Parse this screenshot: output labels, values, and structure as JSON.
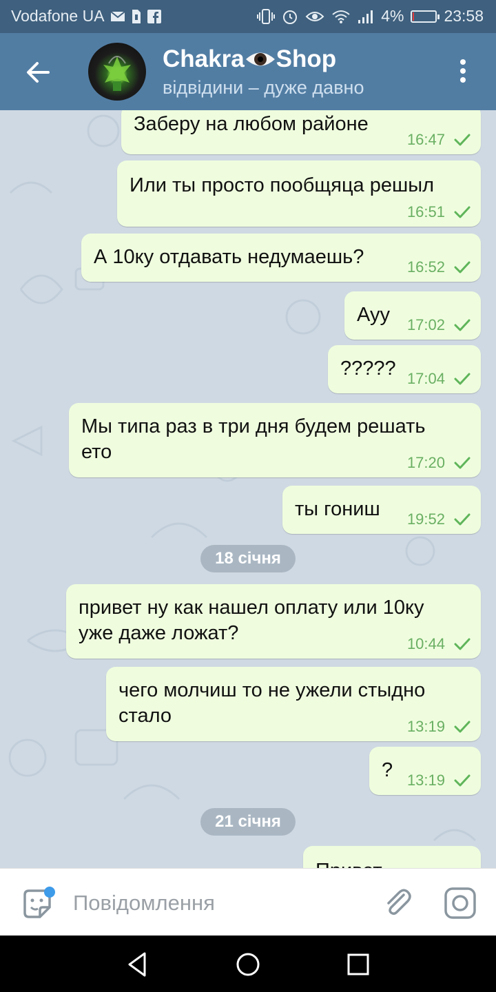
{
  "status_bar": {
    "carrier": "Vodafone UA",
    "battery_percent": "4%",
    "battery_level": 0.04,
    "time": "23:58"
  },
  "header": {
    "title_left": "Chakra",
    "title_right": "Shop",
    "status": "відвідини – дуже давно"
  },
  "messages": [
    {
      "text": "Заберу на любом районе",
      "time": "16:47"
    },
    {
      "text": "Или ты просто пообщяца решыл",
      "time": "16:51"
    },
    {
      "text": "А 10ку отдавать недумаешь?",
      "time": "16:52"
    },
    {
      "text": "Ауу",
      "time": "17:02"
    },
    {
      "text": "?????",
      "time": "17:04"
    },
    {
      "text": "Мы типа раз в три дня будем решать\nето",
      "time": "17:20"
    },
    {
      "text": "ты гониш",
      "time": "19:52"
    },
    {
      "text": "привет ну как нашел оплату или 10ку\nуже даже ложат?",
      "time": "10:44"
    },
    {
      "text": "чего молчиш то не ужели стыдно\nстало",
      "time": "13:19"
    },
    {
      "text": "?",
      "time": "13:19"
    },
    {
      "text": "Привет",
      "time": ""
    }
  ],
  "dates": [
    {
      "label": "18 січня"
    },
    {
      "label": "21 січня"
    }
  ],
  "input": {
    "placeholder": "Повідомлення"
  },
  "colors": {
    "header": "#527da3",
    "status_bar": "#3f607e",
    "bubble": "#effdde",
    "time_text": "#6aaf63",
    "chat_bg": "#cfd9e3"
  },
  "icons": [
    "back-arrow-icon",
    "eye-icon",
    "more-vert-icon",
    "check-icon",
    "sticker-icon",
    "paperclip-icon",
    "camera-icon"
  ]
}
